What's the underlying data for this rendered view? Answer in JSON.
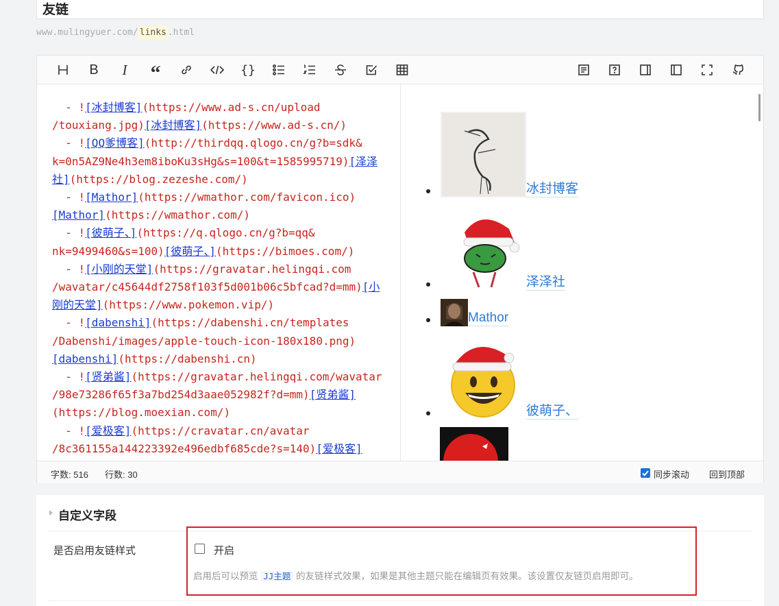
{
  "page": {
    "title": "友链",
    "slug_prefix": "www.mulingyuer.com/",
    "slug": "links",
    "slug_suffix": ".html"
  },
  "toolbar": {
    "icons": [
      "heading-icon",
      "bold-icon",
      "italic-icon",
      "quote-icon",
      "link-icon",
      "code-icon",
      "code-block-icon",
      "unordered-list-icon",
      "ordered-list-icon",
      "strikethrough-icon",
      "task-list-icon",
      "table-icon",
      "preview-icon",
      "help-icon",
      "sidebar-right-icon",
      "sidebar-left-icon",
      "fullscreen-icon",
      "github-icon"
    ],
    "bold": "B",
    "italic": "I",
    "quote": "“",
    "code_block": "{}"
  },
  "editor": {
    "lines": [
      [
        {
          "t": "  - !"
        },
        {
          "t": "[冰封博客]",
          "l": 1
        },
        {
          "t": "(https://www.ad-s.cn/upload"
        }
      ],
      [
        {
          "t": "/touxiang.jpg)"
        },
        {
          "t": "[冰封博客]",
          "l": 1
        },
        {
          "t": "(https://www.ad-s.cn/)"
        }
      ],
      [
        {
          "t": "  - !"
        },
        {
          "t": "[QQ爹博客]",
          "l": 1
        },
        {
          "t": "(http://thirdqq.qlogo.cn/g?b=sdk&"
        }
      ],
      [
        {
          "t": "k=0n5AZ9Ne4h3em8iboKu3sHg&s=100&t=1585995719)"
        },
        {
          "t": "[泽泽",
          "l": 1
        }
      ],
      [
        {
          "t": "社]",
          "l": 1
        },
        {
          "t": "(https://blog.zezeshe.com/)"
        }
      ],
      [
        {
          "t": "  - !"
        },
        {
          "t": "[Mathor]",
          "l": 1
        },
        {
          "t": "(https://wmathor.com/favicon.ico)"
        }
      ],
      [
        {
          "t": "[Mathor]",
          "l": 1
        },
        {
          "t": "(https://wmathor.com/)"
        }
      ],
      [
        {
          "t": "  - !"
        },
        {
          "t": "[彼萌子、]",
          "l": 1
        },
        {
          "t": "(https://q.qlogo.cn/g?b=qq&"
        }
      ],
      [
        {
          "t": "nk=9499460&s=100)"
        },
        {
          "t": "[彼萌子、]",
          "l": 1
        },
        {
          "t": "(https://bimoes.com/)"
        }
      ],
      [
        {
          "t": "  - !"
        },
        {
          "t": "[小刚的天堂]",
          "l": 1
        },
        {
          "t": "(https://gravatar.helingqi.com"
        }
      ],
      [
        {
          "t": "/wavatar/c45644df2758f103f5d001b06c5bfcad?d=mm)"
        },
        {
          "t": "[小",
          "l": 1
        }
      ],
      [
        {
          "t": "刚的天堂]",
          "l": 1
        },
        {
          "t": "(https://www.pokemon.vip/)"
        }
      ],
      [
        {
          "t": "  - !"
        },
        {
          "t": "[dabenshi]",
          "l": 1
        },
        {
          "t": "(https://dabenshi.cn/templates"
        }
      ],
      [
        {
          "t": "/Dabenshi/images/apple-touch-icon-180x180.png)"
        }
      ],
      [
        {
          "t": "[dabenshi]",
          "l": 1
        },
        {
          "t": "(https://dabenshi.cn)"
        }
      ],
      [
        {
          "t": "  - !"
        },
        {
          "t": "[贤弟酱]",
          "l": 1
        },
        {
          "t": "(https://gravatar.helingqi.com/wavatar"
        }
      ],
      [
        {
          "t": "/98e73286f65f3a7bd254d3aae052982f?d=mm)"
        },
        {
          "t": "[贤弟酱]",
          "l": 1
        }
      ],
      [
        {
          "t": "(https://blog.moexian.com/)"
        }
      ],
      [
        {
          "t": "  - !"
        },
        {
          "t": "[爱极客]",
          "l": 1
        },
        {
          "t": "(https://cravatar.cn/avatar"
        }
      ],
      [
        {
          "t": "/8c361155a144223392e496edbf685cde?s=140)"
        },
        {
          "t": "[爱极客]",
          "l": 1
        }
      ]
    ]
  },
  "preview": {
    "items": [
      "冰封博客",
      "泽泽社",
      "Mathor",
      "彼萌子、"
    ]
  },
  "status": {
    "chars_label": "字数: 516",
    "lines_label": "行数: 30",
    "sync_label": "同步滚动",
    "top_label": "回到顶部"
  },
  "custom_fields": {
    "section_title": "自定义字段",
    "field_label": "是否启用友链样式",
    "checkbox_label": "开启",
    "hint_before": "启用后可以预览",
    "hint_code": "JJ主题",
    "hint_after": "的友链样式效果，如果是其他主题只能在编辑页有效果。该设置仅友链页启用即可。"
  },
  "colors": {
    "code_text": "#c7251e",
    "code_link": "#1a3bd1",
    "preview_link": "#2e7bd6",
    "highlight_border": "#d4202a",
    "accent": "#1e6fd9"
  }
}
